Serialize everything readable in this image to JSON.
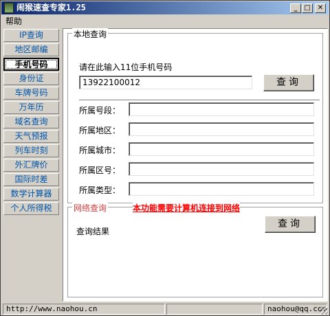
{
  "window": {
    "title": "闹猴速查专家1.25",
    "minimize": "_",
    "maximize": "□",
    "close": "✕"
  },
  "menu": {
    "help": "帮助"
  },
  "sidebar": {
    "items": [
      {
        "label": "IP查询"
      },
      {
        "label": "地区邮编"
      },
      {
        "label": "手机号码"
      },
      {
        "label": "身份证"
      },
      {
        "label": "车牌号码"
      },
      {
        "label": "万年历"
      },
      {
        "label": "域名查询"
      },
      {
        "label": "天气预报"
      },
      {
        "label": "列车时刻"
      },
      {
        "label": "外汇牌价"
      },
      {
        "label": "国际时差"
      },
      {
        "label": "数学计算器"
      },
      {
        "label": "个人所得税"
      }
    ]
  },
  "local_query": {
    "legend": "本地查询",
    "prompt": "请在此输入11位手机号码",
    "phone_value": "13922100012",
    "query_button": "查询",
    "fields": [
      {
        "label": "所属号段：",
        "value": ""
      },
      {
        "label": "所属地区：",
        "value": ""
      },
      {
        "label": "所属城市：",
        "value": ""
      },
      {
        "label": "所属区号：",
        "value": ""
      },
      {
        "label": "所属类型：",
        "value": ""
      }
    ]
  },
  "network_query": {
    "legend": "网络查询",
    "notice": "本功能需要计算机连接到网络",
    "result_label": "查询结果",
    "query_button": "查询"
  },
  "status": {
    "url": "http://www.naohou.cn",
    "email": "naohou@qq.com"
  },
  "colors": {
    "nav_text": "#0055aa",
    "notice": "#ff0000",
    "network_legend": "#d04040"
  }
}
